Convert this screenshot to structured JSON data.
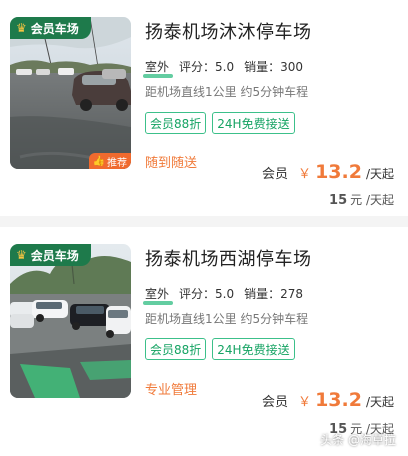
{
  "colors": {
    "accent_orange": "#f07a3a",
    "tag_green": "#15a363",
    "member_badge_green": "#1e7a4b"
  },
  "listings": [
    {
      "member_badge": "会员车场",
      "crown_icon": "crown-icon",
      "recommend_tag": "推荐",
      "title": "扬泰机场沐沐停车场",
      "env": "室外",
      "rating_label": "评分：",
      "rating": "5.0",
      "sales_label": "销量：",
      "sales": "300",
      "distance": "距机场直线1公里 约5分钟车程",
      "tags": [
        "会员88折",
        "24H免费接送"
      ],
      "promo": "随到随送",
      "price_label": "会员",
      "currency": "￥",
      "price": "13.2",
      "price_unit": "/天起",
      "orig_price": "15",
      "orig_unit": "元 /天起"
    },
    {
      "member_badge": "会员车场",
      "crown_icon": "crown-icon",
      "title": "扬泰机场西湖停车场",
      "env": "室外",
      "rating_label": "评分：",
      "rating": "5.0",
      "sales_label": "销量：",
      "sales": "278",
      "distance": "距机场直线1公里 约5分钟车程",
      "tags": [
        "会员88折",
        "24H免费接送"
      ],
      "promo": "专业管理",
      "price_label": "会员",
      "currency": "￥",
      "price": "13.2",
      "price_unit": "/天起",
      "orig_price": "15",
      "orig_unit": "元 /天起"
    }
  ],
  "watermark": "头条 @海草拉"
}
